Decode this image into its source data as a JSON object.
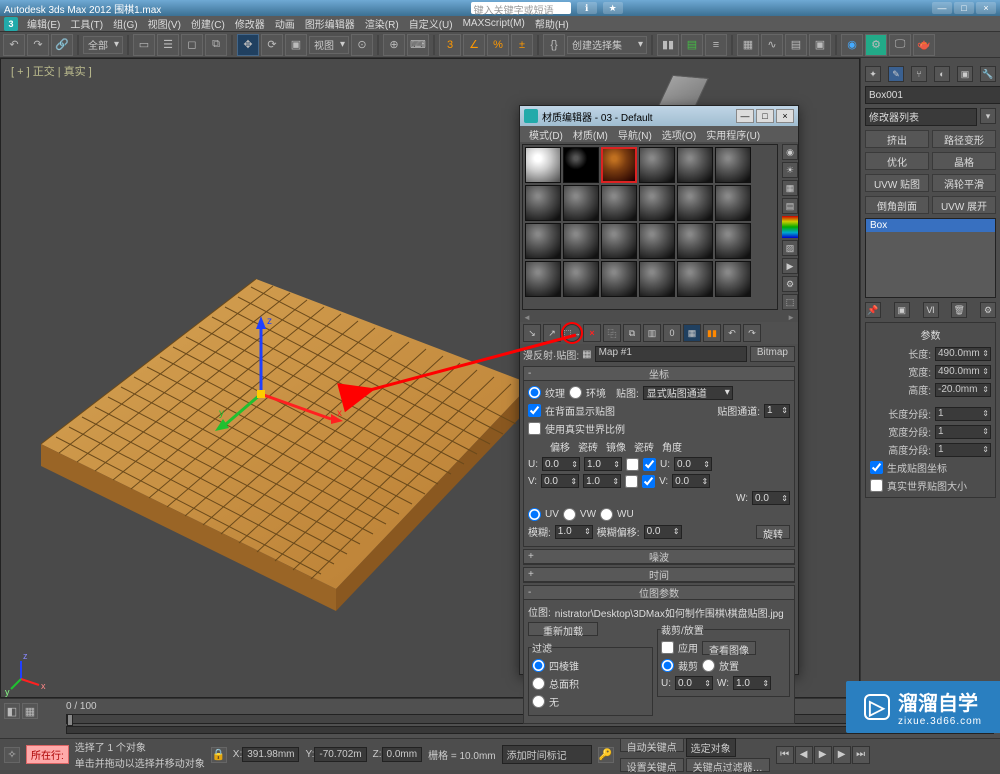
{
  "titlebar": {
    "title": "Autodesk 3ds Max 2012        围棋1.max",
    "search_placeholder": "键入关键字或短语",
    "min": "—",
    "max": "□",
    "close": "×"
  },
  "menubar": {
    "items": [
      "编辑(E)",
      "工具(T)",
      "组(G)",
      "视图(V)",
      "创建(C)",
      "修改器",
      "动画",
      "图形编辑器",
      "渲染(R)",
      "自定义(U)",
      "MAXScript(M)",
      "帮助(H)"
    ]
  },
  "toolbar": {
    "all_label": "全部",
    "view_label": "视图",
    "sel_label": "创建选择集"
  },
  "viewport": {
    "label": "[ + ]  正交 | 真实 ]"
  },
  "rightpanel": {
    "obj_name": "Box001",
    "modlist_label": "修改器列表",
    "btns": [
      [
        "挤出",
        "路径变形"
      ],
      [
        "优化",
        "晶格"
      ],
      [
        "UVW 贴图",
        "涡轮平滑"
      ],
      [
        "倒角剖面",
        "UVW 展开"
      ]
    ],
    "list_item": "Box",
    "section_title": "参数",
    "params": [
      {
        "label": "长度:",
        "value": "490.0mm"
      },
      {
        "label": "宽度:",
        "value": "490.0mm"
      },
      {
        "label": "高度:",
        "value": "-20.0mm"
      },
      {
        "label": "长度分段:",
        "value": "1"
      },
      {
        "label": "宽度分段:",
        "value": "1"
      },
      {
        "label": "高度分段:",
        "value": "1"
      }
    ],
    "chk1": "生成贴图坐标",
    "chk2": "真实世界贴图大小"
  },
  "matwin": {
    "title": "材质编辑器 - 03 - Default",
    "menus": [
      "模式(D)",
      "材质(M)",
      "导航(N)",
      "选项(O)",
      "实用程序(U)"
    ],
    "path_label": "漫反射·贴图:",
    "map_name": "Map #1",
    "map_type": "Bitmap",
    "roll_coord": "坐标",
    "r_texture": "纹理",
    "r_env": "环境",
    "r_maplabel": "贴图:",
    "r_mapdrop": "显式贴图通道",
    "r_showmap": "在背面显示贴图",
    "r_channellabel": "贴图通道:",
    "r_channelval": "1",
    "r_realworld": "使用真实世界比例",
    "h_offset": "偏移",
    "h_tiling": "瓷砖",
    "h_mirror": "镜像",
    "h_tile": "瓷砖",
    "h_angle": "角度",
    "u_label": "U:",
    "v_label": "V:",
    "w_label": "W:",
    "uv": "UV",
    "vw": "VW",
    "wu": "WU",
    "zero": "0.0",
    "one": "1.0",
    "blur_label": "模糊:",
    "blur_val": "1.0",
    "bluroff_label": "模糊偏移:",
    "bluroff_val": "0.0",
    "rotate_btn": "旋转",
    "roll_noise": "噪波",
    "roll_time": "时间",
    "roll_bitparams": "位图参数",
    "bitmap_label": "位图:",
    "bitmap_path": "nistrator\\Desktop\\3DMax如何制作围棋\\棋盘贴图.jpg",
    "reload_btn": "重新加载",
    "crop_label": "裁剪/放置",
    "apply": "应用",
    "viewimg": "查看图像",
    "cropopt": "裁剪",
    "placeopt": "放置",
    "filter_label": "过滤",
    "pyramid": "四棱锥",
    "summed": "总面积",
    "none": "无"
  },
  "statusbar": {
    "range": "0 / 100",
    "sel": "选择了 1 个对象",
    "hint": "单击并拖动以选择并移动对象",
    "x": "391.98mm",
    "y": "-70.702m",
    "z": "0.0mm",
    "grid": "栅格 = 10.0mm",
    "addkey_label": "添加时间标记",
    "autokey": "自动关键点",
    "setkey": "设置关键点",
    "selset": "选定对象",
    "keyfilter": "关键点过滤器…",
    "pinkbar": "所在行:"
  },
  "watermark": {
    "big": "溜溜自学",
    "small": "zixue.3d66.com"
  }
}
